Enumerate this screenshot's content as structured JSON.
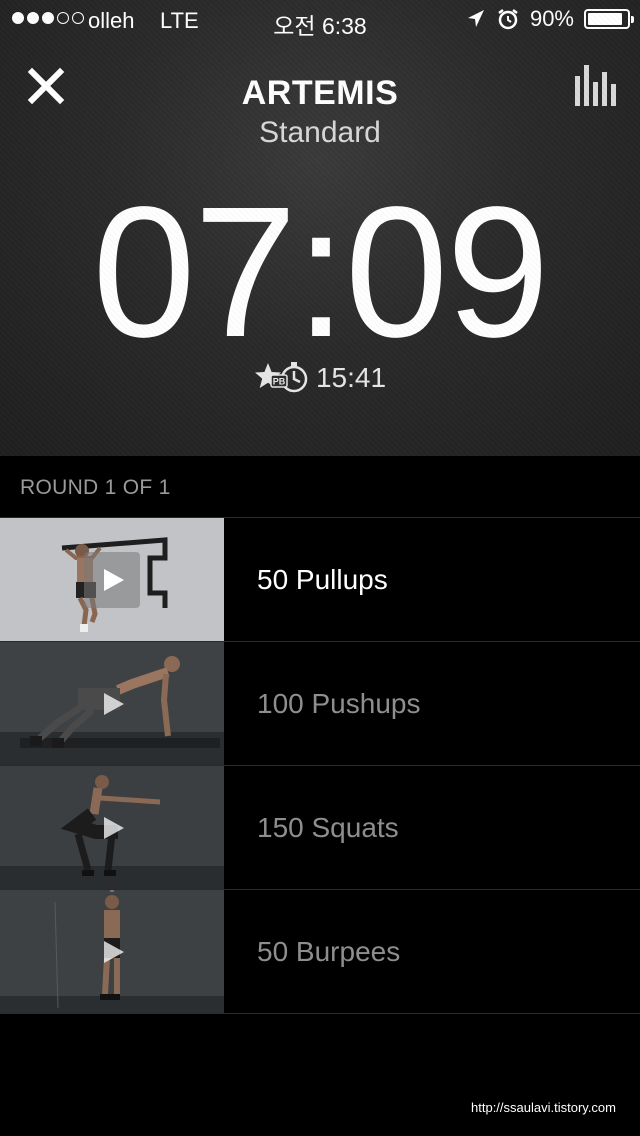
{
  "status_bar": {
    "carrier": "olleh",
    "network": "LTE",
    "time": "오전 6:38",
    "battery_percent_label": "90%",
    "battery_level": 0.9,
    "signal_strength": 3,
    "signal_max": 5
  },
  "header": {
    "title": "ARTEMIS",
    "subtitle": "Standard"
  },
  "timer": {
    "elapsed": "07:09",
    "personal_best": "15:41",
    "pb_badge": "PB"
  },
  "round_label": "ROUND 1 OF 1",
  "exercises": [
    {
      "label": "50 Pullups",
      "active": true
    },
    {
      "label": "100 Pushups",
      "active": false
    },
    {
      "label": "150 Squats",
      "active": false
    },
    {
      "label": "50 Burpees",
      "active": false
    }
  ],
  "watermark": "http://ssaulavi.tistory.com",
  "colors": {
    "background": "#000000",
    "hero_background": "#2a2a2a",
    "active_text": "#ffffff",
    "inactive_text": "#8e8e8e",
    "divider": "#2a2a2a"
  }
}
